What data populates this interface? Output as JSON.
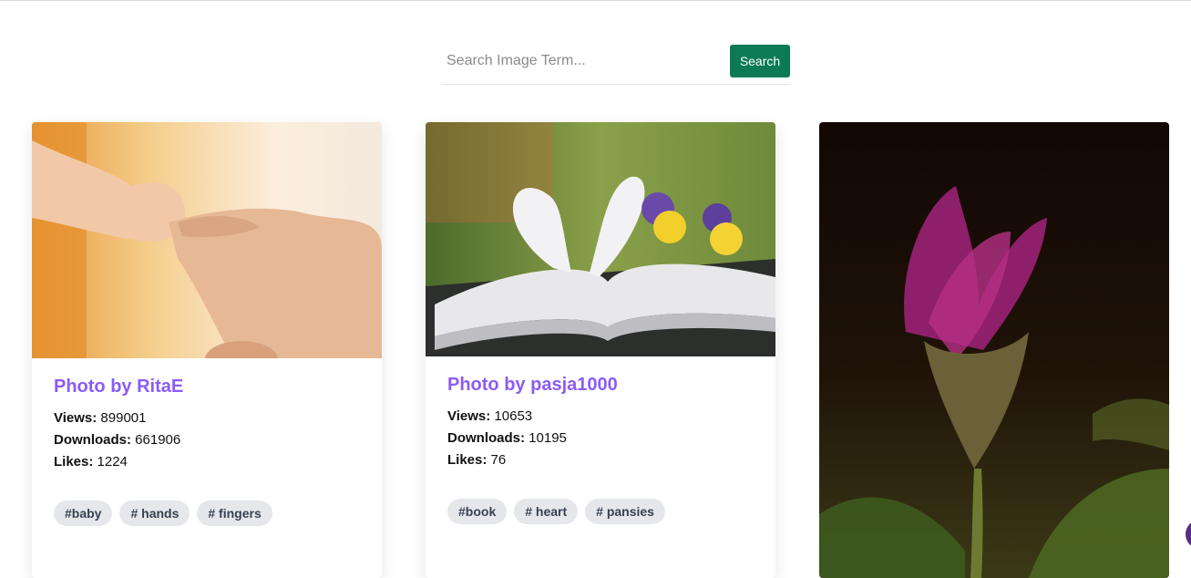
{
  "search": {
    "placeholder": "Search Image Term...",
    "button_label": "Search",
    "button_color": "#0b7a55"
  },
  "cards": [
    {
      "image_alt": "baby hand holding adult finger",
      "title": "Photo by RitaE",
      "views_label": "Views:",
      "views": "899001",
      "downloads_label": "Downloads:",
      "downloads": "661906",
      "likes_label": "Likes:",
      "likes": "1224",
      "tags": [
        "#baby",
        "# hands",
        "# fingers"
      ]
    },
    {
      "image_alt": "book pages folded into heart with pansies",
      "title": "Photo by pasja1000",
      "views_label": "Views:",
      "views": "10653",
      "downloads_label": "Downloads:",
      "downloads": "10195",
      "likes_label": "Likes:",
      "likes": "76",
      "tags": [
        "#book",
        "# heart",
        "# pansies"
      ]
    },
    {
      "image_alt": "purple pasque flower against dark background"
    }
  ],
  "colors": {
    "title": "#8b5cf6",
    "tag_bg": "#e5e7eb"
  }
}
